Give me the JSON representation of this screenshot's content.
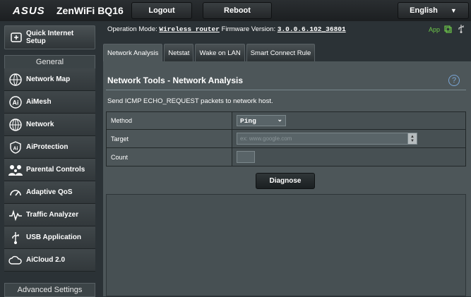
{
  "header": {
    "brand": "ASUS",
    "model": "ZenWiFi BQ16",
    "logout_label": "Logout",
    "reboot_label": "Reboot",
    "language": "English"
  },
  "status": {
    "op_mode_label": "Operation Mode:",
    "op_mode_value": "Wireless router",
    "fw_label": "Firmware Version:",
    "fw_value": "3.0.0.6.102_36801",
    "app_label": "App"
  },
  "sidebar": {
    "quick_setup": "Quick Internet Setup",
    "general_header": "General",
    "items": [
      {
        "label": "Network Map",
        "icon": "network-map-icon"
      },
      {
        "label": "AiMesh",
        "icon": "aimesh-icon"
      },
      {
        "label": "Network",
        "icon": "globe-icon"
      },
      {
        "label": "AiProtection",
        "icon": "shield-icon"
      },
      {
        "label": "Parental Controls",
        "icon": "family-icon"
      },
      {
        "label": "Adaptive QoS",
        "icon": "gauge-icon"
      },
      {
        "label": "Traffic Analyzer",
        "icon": "pulse-icon"
      },
      {
        "label": "USB Application",
        "icon": "usb-icon"
      },
      {
        "label": "AiCloud 2.0",
        "icon": "cloud-icon"
      }
    ],
    "advanced_header": "Advanced Settings"
  },
  "tabs": [
    {
      "label": "Network Analysis",
      "active": true
    },
    {
      "label": "Netstat",
      "active": false
    },
    {
      "label": "Wake on LAN",
      "active": false
    },
    {
      "label": "Smart Connect Rule",
      "active": false
    }
  ],
  "main": {
    "title": "Network Tools - Network Analysis",
    "description": "Send ICMP ECHO_REQUEST packets to network host.",
    "method_label": "Method",
    "method_value": "Ping",
    "target_label": "Target",
    "target_placeholder": "ex: www.google.com",
    "count_label": "Count",
    "count_value": "",
    "diagnose_label": "Diagnose"
  },
  "colors": {
    "accent_green": "#6ec84a",
    "help_blue": "#7aa6d6"
  }
}
